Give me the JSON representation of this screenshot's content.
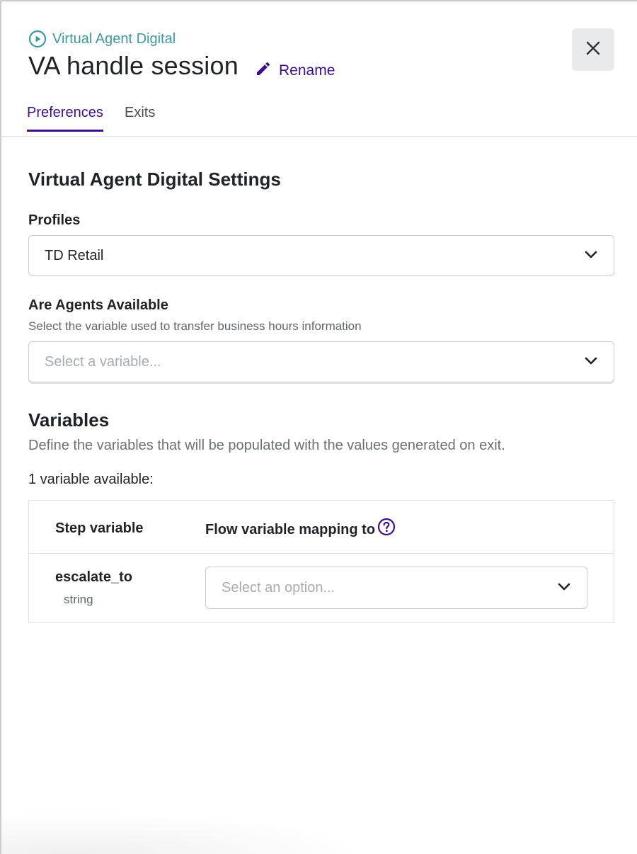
{
  "header": {
    "breadcrumb": "Virtual Agent Digital",
    "breadcrumb_icon": "play-circle-icon",
    "title": "VA handle session",
    "rename_label": "Rename",
    "rename_icon": "pencil-icon",
    "close_icon": "close-icon"
  },
  "tabs": [
    {
      "label": "Preferences",
      "active": true
    },
    {
      "label": "Exits",
      "active": false
    }
  ],
  "settings": {
    "heading": "Virtual Agent Digital Settings",
    "profiles": {
      "label": "Profiles",
      "value": "TD Retail"
    },
    "agents_available": {
      "label": "Are Agents Available",
      "help": "Select the variable used to transfer business hours information",
      "placeholder": "Select a variable..."
    }
  },
  "variables": {
    "heading": "Variables",
    "description": "Define the variables that will be populated with the values generated on exit.",
    "count_text": "1 variable available:",
    "columns": [
      "Step variable",
      "Flow variable mapping to"
    ],
    "rows": [
      {
        "name": "escalate_to",
        "type": "string",
        "mapping_placeholder": "Select an option..."
      }
    ]
  },
  "colors": {
    "accent": "#3d0f8c",
    "breadcrumb": "#3a9aa0",
    "placeholder": "#a6abb2"
  }
}
